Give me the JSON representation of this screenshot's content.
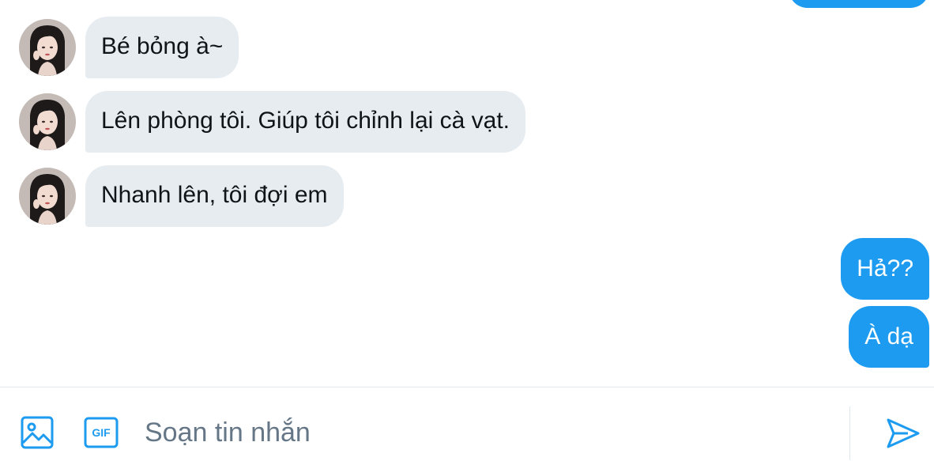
{
  "conversation": {
    "incoming": [
      {
        "text": "Bé bỏng à~",
        "avatar": "avatar"
      },
      {
        "text": "Lên phòng tôi. Giúp tôi chỉnh lại cà vạt.",
        "avatar": "avatar"
      },
      {
        "text": "Nhanh lên, tôi đợi em",
        "avatar": "avatar"
      }
    ],
    "outgoing": [
      {
        "text": "Hả??"
      },
      {
        "text": "À dạ"
      }
    ]
  },
  "composer": {
    "placeholder": "Soạn tin nhắn",
    "gif_label": "GIF",
    "icons": [
      "image-icon",
      "gif-icon",
      "send-icon"
    ]
  },
  "colors": {
    "accent": "#1d9bf0",
    "incoming_bubble": "#e7ecf0",
    "text": "#0f1419",
    "placeholder": "#657786"
  }
}
